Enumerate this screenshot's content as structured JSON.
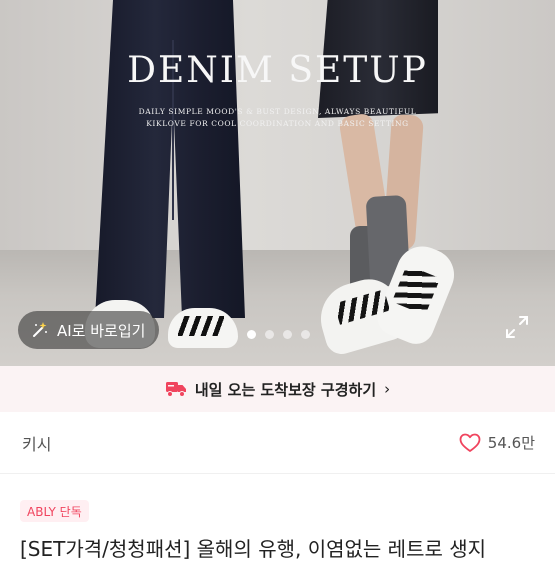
{
  "product_image": {
    "headline": "DENIM SETUP",
    "subline_1": "DAILY SIMPLE MOOD'S & BUST DESIGN, ALWAYS BEAUTIFUL",
    "subline_2": "KIKLOVE FOR COOL COORDINATION AND BASIC SETTING",
    "ai_button_label": "AI로 바로입기",
    "ai_icon": "magic-wand-icon",
    "expand_icon": "expand-icon",
    "carousel": {
      "total": 4,
      "active_index": 0
    }
  },
  "delivery_banner": {
    "icon": "truck-icon",
    "text": "내일 오는 도착보장 구경하기",
    "arrow": "›"
  },
  "shop": {
    "name": "키시",
    "likes": "54.6만",
    "heart_icon": "heart-outline-icon"
  },
  "badge": {
    "label": "ABLY 단독"
  },
  "product": {
    "title": "[SET가격/청청패션] 올해의 유행, 이염없는 레트로 생지"
  },
  "colors": {
    "accent": "#f0445e",
    "banner_bg": "#fbf3f4",
    "badge_bg": "#ffeff2"
  }
}
